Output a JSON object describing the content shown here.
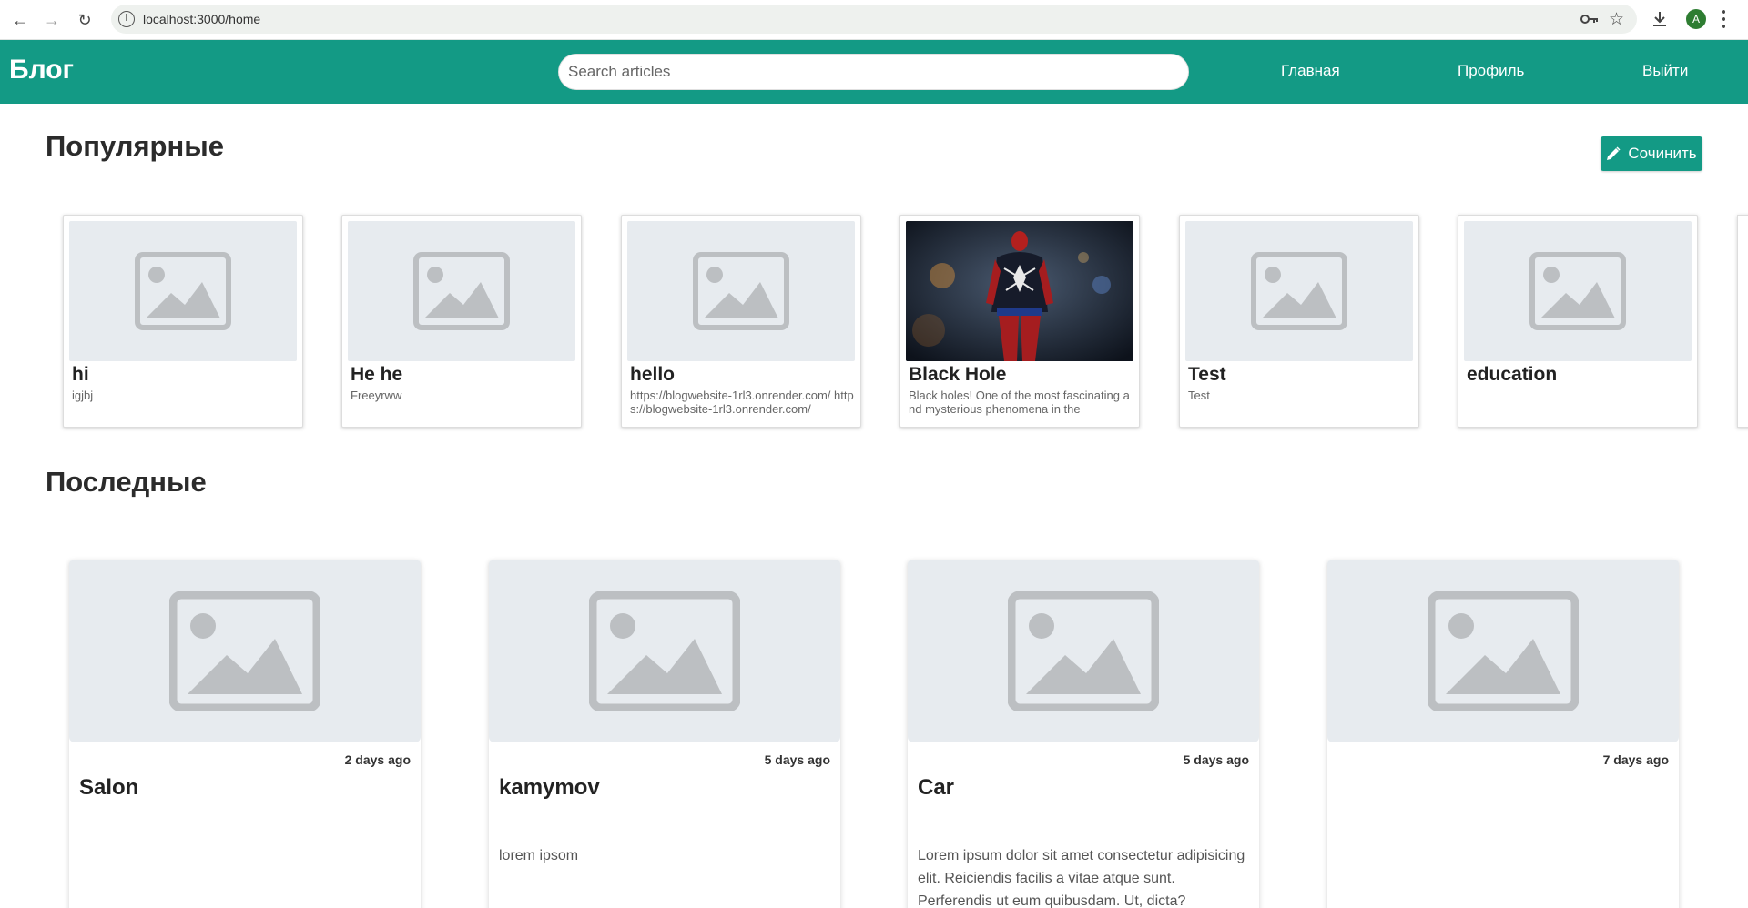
{
  "browser": {
    "url": "localhost:3000/home",
    "profile_initial": "A"
  },
  "header": {
    "brand": "Блог",
    "search_placeholder": "Search articles",
    "nav": {
      "home": "Главная",
      "profile": "Профиль",
      "logout": "Выйти"
    },
    "accent_color": "#139a85"
  },
  "popular": {
    "title": "Популярные",
    "compose_label": "Сочинить",
    "cards": [
      {
        "title": "hi",
        "excerpt": "igjbj",
        "image": "placeholder"
      },
      {
        "title": "He he",
        "excerpt": "Freeyrww",
        "image": "placeholder"
      },
      {
        "title": "hello",
        "excerpt": "https://blogwebsite-1rl3.onrender.com/ https://blogwebsite-1rl3.onrender.com/",
        "image": "placeholder"
      },
      {
        "title": "Black Hole",
        "excerpt": "Black holes! One of the most fascinating and mysterious phenomena in the",
        "image": "photo-spiderman"
      },
      {
        "title": "Test",
        "excerpt": "Test",
        "image": "placeholder"
      },
      {
        "title": "education",
        "excerpt": "",
        "image": "placeholder"
      }
    ]
  },
  "latest": {
    "title": "Последные",
    "cards": [
      {
        "title": "Salon",
        "date": "2 days ago",
        "excerpt": ""
      },
      {
        "title": "kamymov",
        "date": "5 days ago",
        "excerpt": "lorem ipsom"
      },
      {
        "title": "Car",
        "date": "5 days ago",
        "excerpt": "Lorem ipsum dolor sit amet consectetur adipisicing elit. Reiciendis facilis a vitae atque sunt. Perferendis ut eum quibusdam. Ut, dicta?"
      },
      {
        "title": "",
        "date": "7 days ago",
        "excerpt": ""
      }
    ]
  }
}
